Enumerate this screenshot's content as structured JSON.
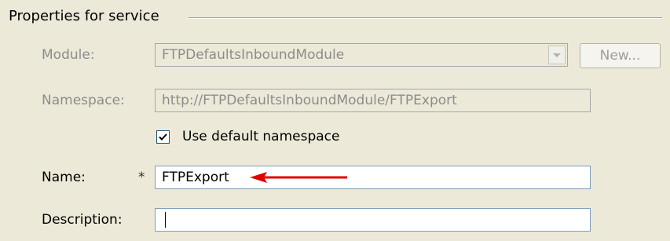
{
  "group": {
    "title": "Properties for service"
  },
  "module": {
    "label": "Module:",
    "value": "FTPDefaultsInboundModule",
    "new_button": "New..."
  },
  "namespace": {
    "label": "Namespace:",
    "value": "http://FTPDefaultsInboundModule/FTPExport"
  },
  "use_default_namespace": {
    "label": "Use default namespace",
    "checked": true
  },
  "name": {
    "label": "Name:",
    "required_marker": "*",
    "value": "FTPExport"
  },
  "description": {
    "label": "Description:",
    "value": ""
  },
  "colors": {
    "arrow": "#e00000",
    "window_bg": "#ece9d8"
  },
  "icons": {
    "arrow": "red-arrow-icon",
    "dropdown": "chevron-down-icon",
    "check": "checkmark-icon"
  }
}
